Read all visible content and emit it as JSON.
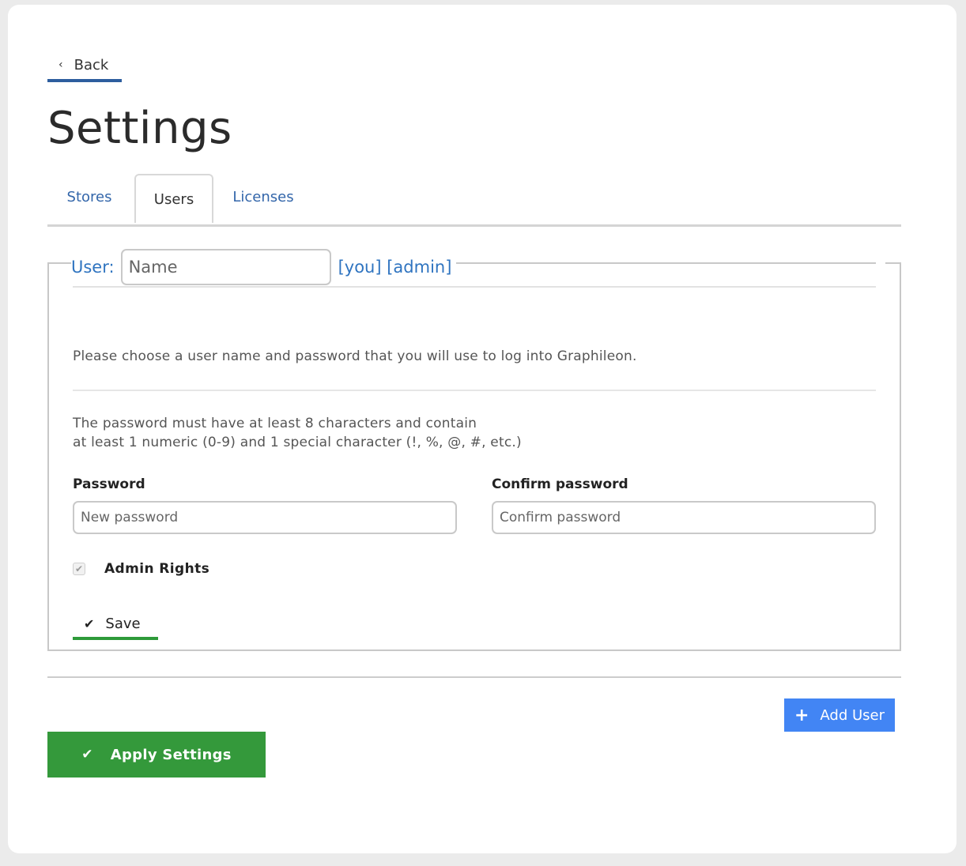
{
  "nav": {
    "back_label": "Back",
    "back_icon": "chevron-left-icon"
  },
  "page": {
    "title": "Settings"
  },
  "tabs": [
    {
      "label": "Stores",
      "active": false
    },
    {
      "label": "Users",
      "active": true
    },
    {
      "label": "Licenses",
      "active": false
    }
  ],
  "user_form": {
    "legend_label": "User:",
    "name_value": "",
    "name_placeholder": "Name",
    "tags": "[you] [admin]",
    "intro_text": "Please choose a user name and password that you will use to log into Graphileon.",
    "rules_line1": "The password must have at least 8 characters and contain",
    "rules_line2": "at least 1 numeric (0-9) and 1 special character (!, %, @, #, etc.)",
    "password_label": "Password",
    "password_placeholder": "New password",
    "password_value": "",
    "confirm_label": "Confirm password",
    "confirm_placeholder": "Confirm password",
    "confirm_value": "",
    "admin_rights_label": "Admin Rights",
    "admin_rights_checked": true,
    "admin_rights_disabled": true,
    "save_label": "Save"
  },
  "actions": {
    "add_user_label": "Add User",
    "apply_label": "Apply Settings"
  },
  "colors": {
    "link_blue": "#3366aa",
    "legend_blue": "#2f74c0",
    "back_underline": "#2d5e9e",
    "save_underline": "#2e9a3a",
    "add_user_bg": "#4285f4",
    "apply_bg": "#34993b"
  }
}
